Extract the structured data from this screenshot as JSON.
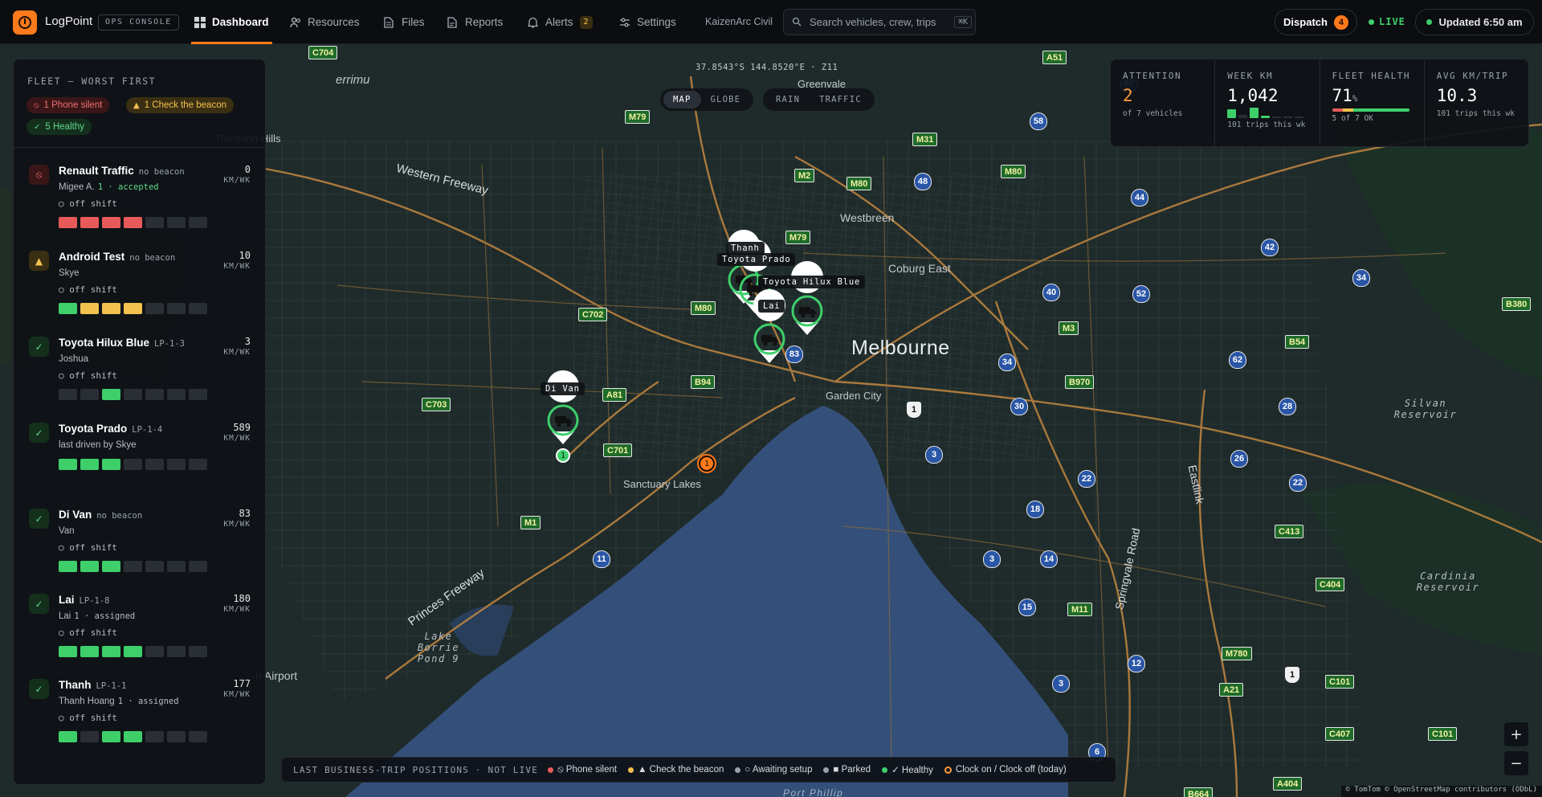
{
  "app": {
    "brand": "LogPoint",
    "tag": "OPS CONSOLE",
    "org": "KaizenArc Civil"
  },
  "nav": [
    {
      "label": "Dashboard",
      "icon": "grid-icon",
      "active": true
    },
    {
      "label": "Resources",
      "icon": "people-icon"
    },
    {
      "label": "Files",
      "icon": "file-icon"
    },
    {
      "label": "Reports",
      "icon": "report-icon"
    },
    {
      "label": "Alerts",
      "icon": "bell-icon",
      "count": "2"
    },
    {
      "label": "Settings",
      "icon": "sliders-icon"
    }
  ],
  "search": {
    "placeholder": "Search vehicles, crew, trips",
    "shortcut": "⌘K"
  },
  "dispatch": {
    "label": "Dispatch",
    "count": "4"
  },
  "live": {
    "label": "LIVE"
  },
  "updated": {
    "label": "Updated 6:50 am"
  },
  "fleet": {
    "title": "FLEET — WORST FIRST",
    "chips": {
      "phone_silent": "1  Phone silent",
      "check_beacon": "1  Check the beacon",
      "healthy": "5  Healthy"
    },
    "vehicles": [
      {
        "name": "Renault Traffic",
        "tag": "no beacon",
        "sub": "Migee A.",
        "status": "1 · accepted",
        "shift": "○ off shift",
        "km": "0",
        "state": "red",
        "glyph": "⦸",
        "bars": [
          "#e85a5a",
          "#e85a5a",
          "#e85a5a",
          "#e85a5a",
          "#2a2f36",
          "#2a2f36",
          "#2a2f36"
        ]
      },
      {
        "name": "Android Test",
        "tag": "no beacon",
        "sub": "Skye",
        "status": "",
        "shift": "○ off shift",
        "km": "10",
        "state": "amber",
        "glyph": "▲",
        "bars": [
          "#3ecf6b",
          "#f2c14e",
          "#f2c14e",
          "#f2c14e",
          "#2a2f36",
          "#2a2f36",
          "#2a2f36"
        ]
      },
      {
        "name": "Toyota Hilux Blue",
        "tag": "LP-1-3",
        "sub": "Joshua",
        "status": "",
        "shift": "○ off shift",
        "km": "3",
        "state": "green",
        "glyph": "✓",
        "bars": [
          "#2a2f36",
          "#2a2f36",
          "#3ecf6b",
          "#2a2f36",
          "#2a2f36",
          "#2a2f36",
          "#2a2f36"
        ]
      },
      {
        "name": "Toyota Prado",
        "tag": "LP-1-4",
        "sub": "last driven by Skye",
        "status": "",
        "shift": "",
        "km": "589",
        "state": "green",
        "glyph": "✓",
        "bars": [
          "#3ecf6b",
          "#3ecf6b",
          "#3ecf6b",
          "#2a2f36",
          "#2a2f36",
          "#2a2f36",
          "#2a2f36"
        ]
      },
      {
        "name": "Di Van",
        "tag": "no beacon",
        "sub": "Van",
        "status": "",
        "shift": "○ off shift",
        "km": "83",
        "state": "green",
        "glyph": "✓",
        "bars": [
          "#3ecf6b",
          "#3ecf6b",
          "#3ecf6b",
          "#2a2f36",
          "#2a2f36",
          "#2a2f36",
          "#2a2f36"
        ]
      },
      {
        "name": "Lai",
        "tag": "LP-1-8",
        "sub": "Lai",
        "status": "1 · assigned",
        "shift": "○ off shift",
        "km": "180",
        "state": "green",
        "glyph": "✓",
        "bars": [
          "#3ecf6b",
          "#3ecf6b",
          "#3ecf6b",
          "#3ecf6b",
          "#2a2f36",
          "#2a2f36",
          "#2a2f36"
        ]
      },
      {
        "name": "Thanh",
        "tag": "LP-1-1",
        "sub": "Thanh Hoang",
        "status": "1 · assigned",
        "shift": "○ off shift",
        "km": "177",
        "state": "green",
        "glyph": "✓",
        "bars": [
          "#3ecf6b",
          "#2a2f36",
          "#3ecf6b",
          "#3ecf6b",
          "#2a2f36",
          "#2a2f36",
          "#2a2f36"
        ]
      }
    ],
    "km_unit": "KM/WK"
  },
  "stats": {
    "attention": {
      "label": "ATTENTION",
      "value": "2",
      "sub": "of 7 vehicles"
    },
    "week_km": {
      "label": "WEEK KM",
      "value": "1,042",
      "sub": "101 trips this wk"
    },
    "fleet_health": {
      "label": "FLEET HEALTH",
      "value": "71",
      "unit": "%",
      "sub": "5 of 7 OK"
    },
    "avg_km": {
      "label": "AVG KM/TRIP",
      "value": "10.3",
      "sub": "101 trips this wk"
    }
  },
  "map": {
    "coords": "37.8543°S 144.8520°E · Z11",
    "view_modes": [
      "MAP",
      "GLOBE"
    ],
    "overlays": [
      "RAIN",
      "TRAFFIC"
    ],
    "labels": {
      "thanh": "Thanh",
      "prado": "Toyota Prado",
      "hilux": "Toyota Hilux Blue",
      "lai": "Lai",
      "divan": "Di Van"
    },
    "places": [
      "Melbourne",
      "Western Freeway",
      "Westbreen",
      "Coburg East",
      "Garden City",
      "Sanctuary Lakes",
      "Princes Freeway",
      "Lake Borrie Pond 9",
      "Silvan Reservoir",
      "Cardinia Reservoir",
      "Springvale Road",
      "Eastlink",
      "errimu",
      "Greenvale",
      "Port Phillip",
      "n Airport",
      "Pentland Hills"
    ],
    "cluster_a": "1",
    "cluster_b": "1"
  },
  "legend": {
    "caption": "LAST BUSINESS-TRIP POSITIONS · NOT LIVE",
    "items": [
      {
        "label": "⦸ Phone silent",
        "color": "#e85a5a"
      },
      {
        "label": "▲ Check the beacon",
        "color": "#f2c14e"
      },
      {
        "label": "○ Awaiting setup",
        "color": "#9aa3ad"
      },
      {
        "label": "■ Parked",
        "color": "#9aa3ad"
      },
      {
        "label": "✓ Healthy",
        "color": "#3ecf6b"
      },
      {
        "label": "Clock on / Clock off (today)",
        "color": "#ff9a3c"
      }
    ]
  },
  "zoom": {
    "in": "+",
    "out": "−"
  },
  "attribution": "© TomTom © OpenStreetMap contributors (ODbL)"
}
